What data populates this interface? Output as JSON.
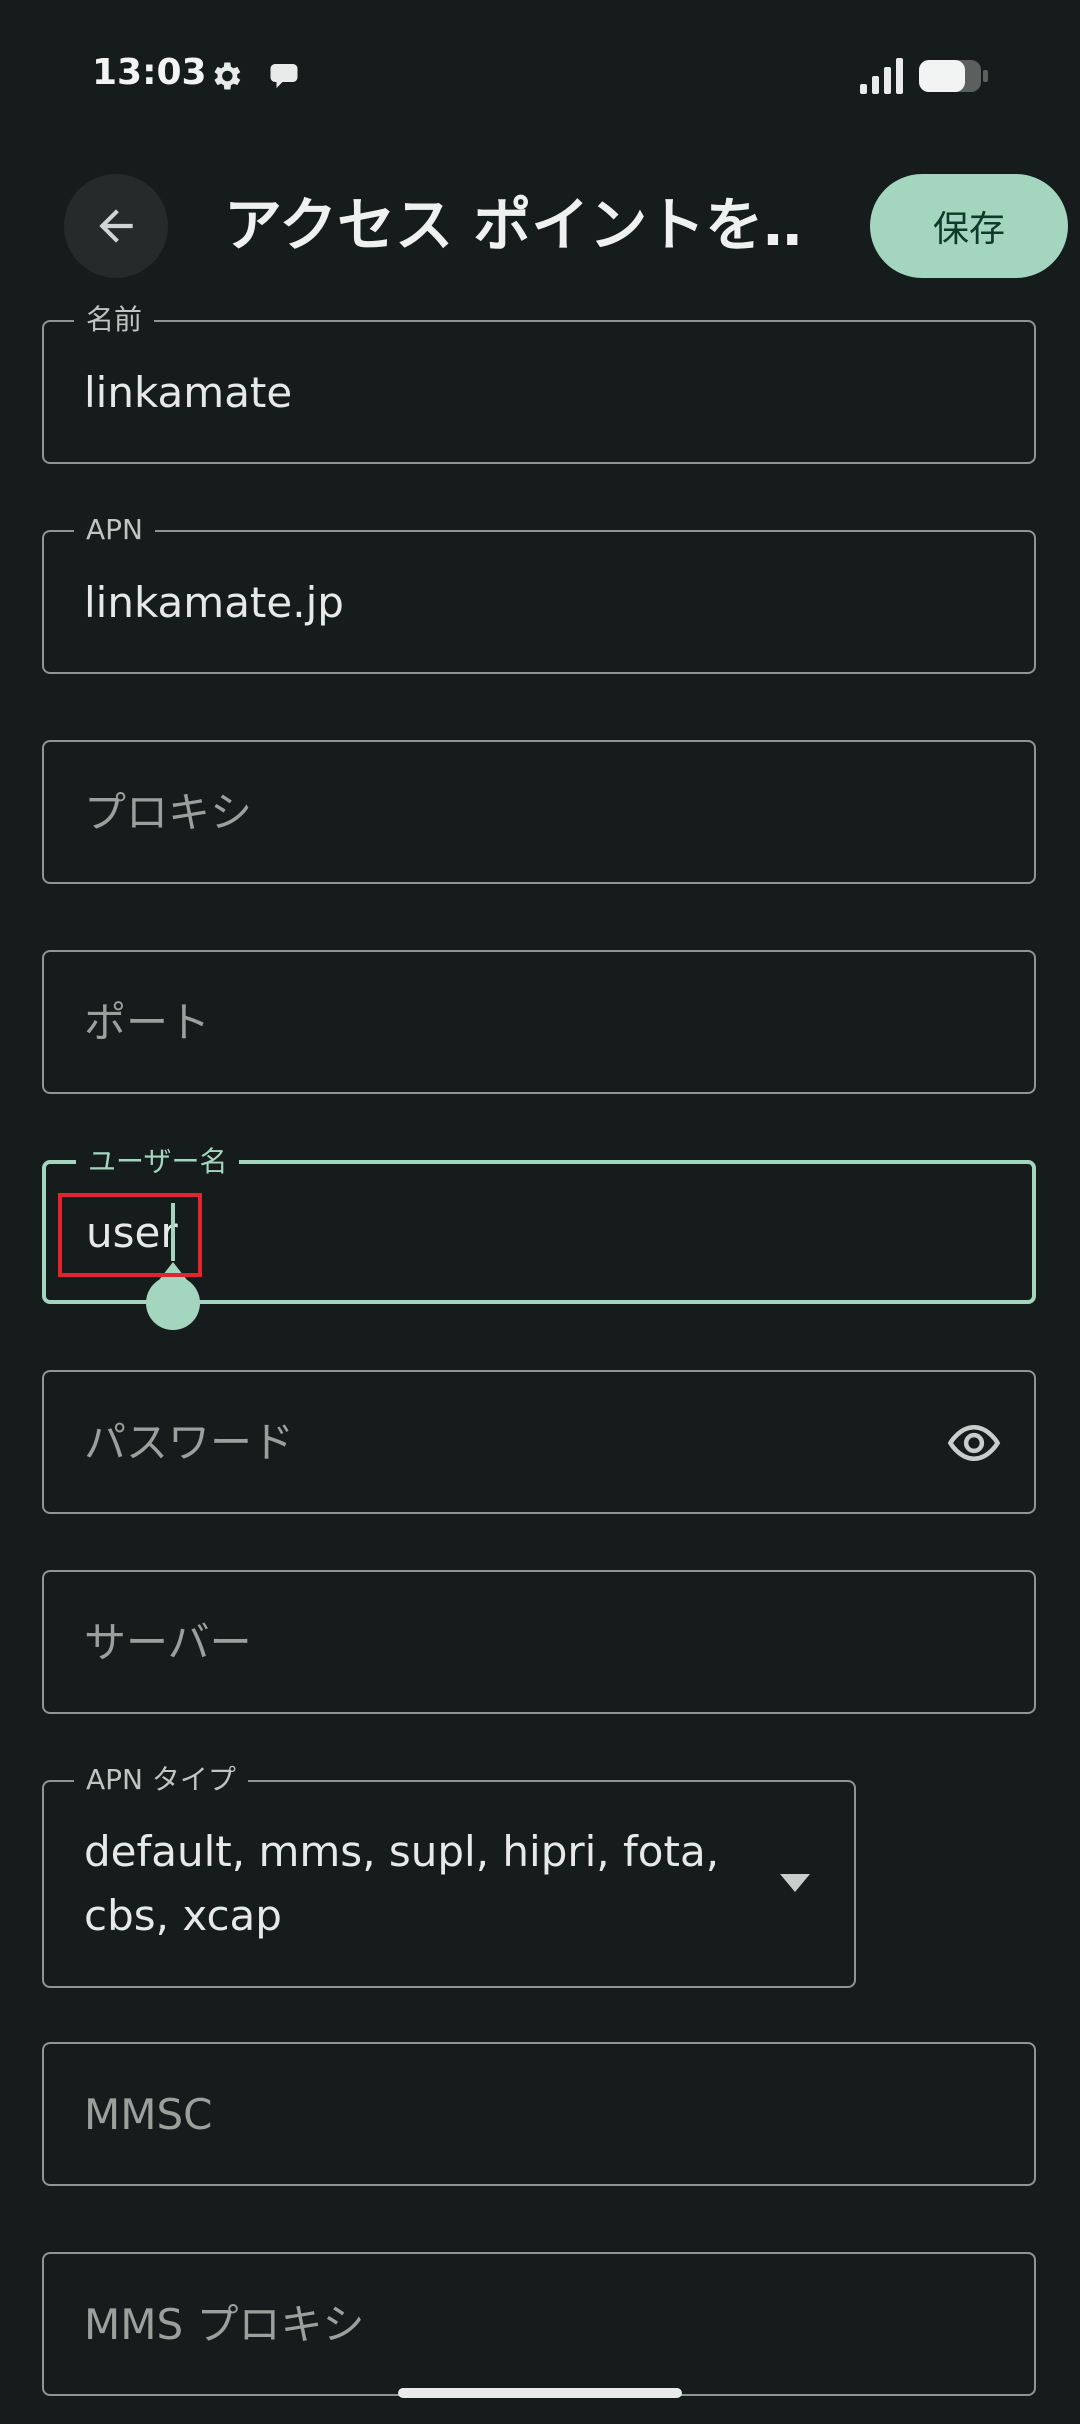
{
  "status_bar": {
    "time": "13:03",
    "icons": [
      "gear-icon",
      "chat-bubble-icon",
      "signal-icon",
      "battery-icon"
    ]
  },
  "app_bar": {
    "back_icon": "arrow-back-icon",
    "title": "アクセス ポイントを…",
    "save_label": "保存"
  },
  "fields": {
    "name": {
      "label": "名前",
      "value": "linkamate"
    },
    "apn": {
      "label": "APN",
      "value": "linkamate.jp"
    },
    "proxy": {
      "placeholder": "プロキシ"
    },
    "port": {
      "placeholder": "ポート"
    },
    "username": {
      "label": "ユーザー名",
      "value": "user"
    },
    "password": {
      "placeholder": "パスワード",
      "icon": "eye-icon"
    },
    "server": {
      "placeholder": "サーバー"
    },
    "apn_type": {
      "label": "APN タイプ",
      "value": "default, mms, supl, hipri, fota, cbs, xcap"
    },
    "mmsc": {
      "placeholder": "MMSC"
    },
    "mms_proxy": {
      "placeholder": "MMS プロキシ"
    }
  },
  "colors": {
    "background": "#161b1b",
    "accent": "#a4d6bf",
    "outline": "#8e9692",
    "highlight": "#e0262c"
  }
}
